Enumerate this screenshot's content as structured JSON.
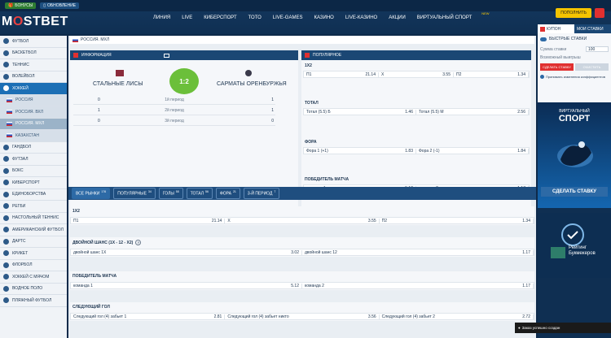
{
  "topstrip": {
    "bonus_label": "БОНУСЫ",
    "app_label": "ОБНОВЛЕНИЕ"
  },
  "logo": {
    "a": "M",
    "o": "O",
    "b": "STBET"
  },
  "nav": [
    {
      "label": "ЛИНИЯ"
    },
    {
      "label": "LIVE"
    },
    {
      "label": "КИБЕРСПОРТ"
    },
    {
      "label": "ТОТО"
    },
    {
      "label": "LIVE-GAMES"
    },
    {
      "label": "КАЗИНО"
    },
    {
      "label": "LIVE-КАЗИНО"
    },
    {
      "label": "АКЦИИ"
    },
    {
      "label": "ВИРТУАЛЬНЫЙ СПОРТ",
      "badge": "NEW"
    }
  ],
  "topright": {
    "deposit_label": "ПОПОЛНИТЬ"
  },
  "sidebar": [
    {
      "label": "ФУТБОЛ",
      "type": "item"
    },
    {
      "label": "БАСКЕТБОЛ",
      "type": "item"
    },
    {
      "label": "ТЕННИС",
      "type": "item"
    },
    {
      "label": "ВОЛЕЙБОЛ",
      "type": "item"
    },
    {
      "label": "ХОККЕЙ",
      "type": "active"
    },
    {
      "label": "РОССИЯ",
      "type": "sub"
    },
    {
      "label": "РОССИЯ. ВХЛ",
      "type": "sub"
    },
    {
      "label": "РОССИЯ. МХЛ",
      "type": "subdark"
    },
    {
      "label": "КАЗАХСТАН",
      "type": "sub"
    },
    {
      "label": "ГАНДБОЛ",
      "type": "item"
    },
    {
      "label": "ФУТЗАЛ",
      "type": "item"
    },
    {
      "label": "БОКС",
      "type": "item"
    },
    {
      "label": "КИБЕРСПОРТ",
      "type": "item"
    },
    {
      "label": "ЕДИНОБОРСТВА",
      "type": "item"
    },
    {
      "label": "РЕГБИ",
      "type": "item"
    },
    {
      "label": "НАСТОЛЬНЫЙ ТЕННИС",
      "type": "item"
    },
    {
      "label": "АМЕРИКАНСКИЙ ФУТБОЛ",
      "type": "item"
    },
    {
      "label": "ДАРТС",
      "type": "item"
    },
    {
      "label": "КРИКЕТ",
      "type": "item"
    },
    {
      "label": "ФЛОРБОЛ",
      "type": "item"
    },
    {
      "label": "ХОККЕЙ С МЯЧОМ",
      "type": "item"
    },
    {
      "label": "ВОДНОЕ ПОЛО",
      "type": "item"
    },
    {
      "label": "ПЛЯЖНЫЙ ФУТБОЛ",
      "type": "item"
    }
  ],
  "breadcrumb": {
    "label": "РОССИЯ. МХЛ"
  },
  "info": {
    "title": "ИНФОРМАЦИЯ",
    "team1": "СТАЛЬНЫЕ ЛИСЫ",
    "team2": "САРМАТЫ ОРЕНБУРЖЬЯ",
    "score": "1:2",
    "periods": [
      {
        "l": "0",
        "name": "1й период",
        "r": "1"
      },
      {
        "l": "1",
        "name": "2й период",
        "r": "1"
      },
      {
        "l": "0",
        "name": "3й период",
        "r": "0"
      }
    ]
  },
  "popular": {
    "title": "ПОПУЛЯРНОЕ",
    "markets": [
      {
        "name": "1X2",
        "odds": [
          [
            "П1",
            "21.14"
          ],
          [
            "X",
            "3.55"
          ],
          [
            "П2",
            "1.34"
          ]
        ]
      },
      {
        "name": "ТОТАЛ",
        "odds": [
          [
            "Тотал (5.5) Б",
            "1.46"
          ],
          [
            "Тотал (5.5) М",
            "2.56"
          ]
        ]
      },
      {
        "name": "ФОРА",
        "odds": [
          [
            "Фора 1 (+1)",
            "1.83"
          ],
          [
            "Фора 2 (-1)",
            "1.84"
          ]
        ]
      },
      {
        "name": "ПОБЕДИТЕЛЬ МАТЧА",
        "odds": [
          [
            "команда 1",
            "5.12"
          ],
          [
            "команда 2",
            "1.17"
          ]
        ]
      }
    ]
  },
  "filters": [
    {
      "label": "ВСЕ РЫНКИ",
      "count": "176",
      "on": true
    },
    {
      "label": "ПОПУЛЯРНЫЕ",
      "count": "34",
      "on": false
    },
    {
      "label": "ГОЛЫ",
      "count": "58",
      "on": false
    },
    {
      "label": "ТОТАЛ",
      "count": "56",
      "on": false
    },
    {
      "label": "ФОРА",
      "count": "21",
      "on": false
    },
    {
      "label": "3-Й ПЕРИОД",
      "count": "7",
      "on": false
    }
  ],
  "markets": [
    {
      "name": "1X2",
      "odds": [
        [
          "П1",
          "21.14"
        ],
        [
          "X",
          "3.55"
        ],
        [
          "П2",
          "1.34"
        ]
      ]
    },
    {
      "name": "ДВОЙНОЙ ШАНС (1X - 12 - X2)",
      "odds": [
        [
          "двойной шанс 1X",
          "3.02"
        ],
        [
          "двойной шанс 12",
          "1.17"
        ]
      ]
    },
    {
      "name": "ПОБЕДИТЕЛЬ МАТЧА",
      "odds": [
        [
          "команда 1",
          "5.12"
        ],
        [
          "команда 2",
          "1.17"
        ]
      ]
    },
    {
      "name": "СЛЕДУЮЩИЙ ГОЛ",
      "odds": [
        [
          "Следующий гол (4) забьет 1",
          "2.81"
        ],
        [
          "Следующий гол (4) забьет никто",
          "3.56"
        ],
        [
          "Следующий гол (4) забьет 2",
          "2.72"
        ]
      ]
    }
  ],
  "coupon": {
    "tab1": "КУПОН",
    "tab2": "МОИ СТАВКИ",
    "fast": "БЫСТРЫЕ СТАВКИ",
    "sum_label": "Сумма ставки",
    "sum_value": "100",
    "win_label": "Возможный выигрыш",
    "place": "СДЕЛАТЬ СТАВКУ",
    "clear": "ОЧИСТИТЬ",
    "accept": "Принимать изменения коэффициентов"
  },
  "promo": {
    "line1": "ВИРТУАЛЬНЫЙ",
    "line2": "СПОРТ",
    "cta": "СДЕЛАТЬ СТАВКУ"
  },
  "rating": {
    "line1": "Рейтинг",
    "line2": "Букмекеров"
  },
  "toast": {
    "text": "Заказ успешно создан"
  }
}
